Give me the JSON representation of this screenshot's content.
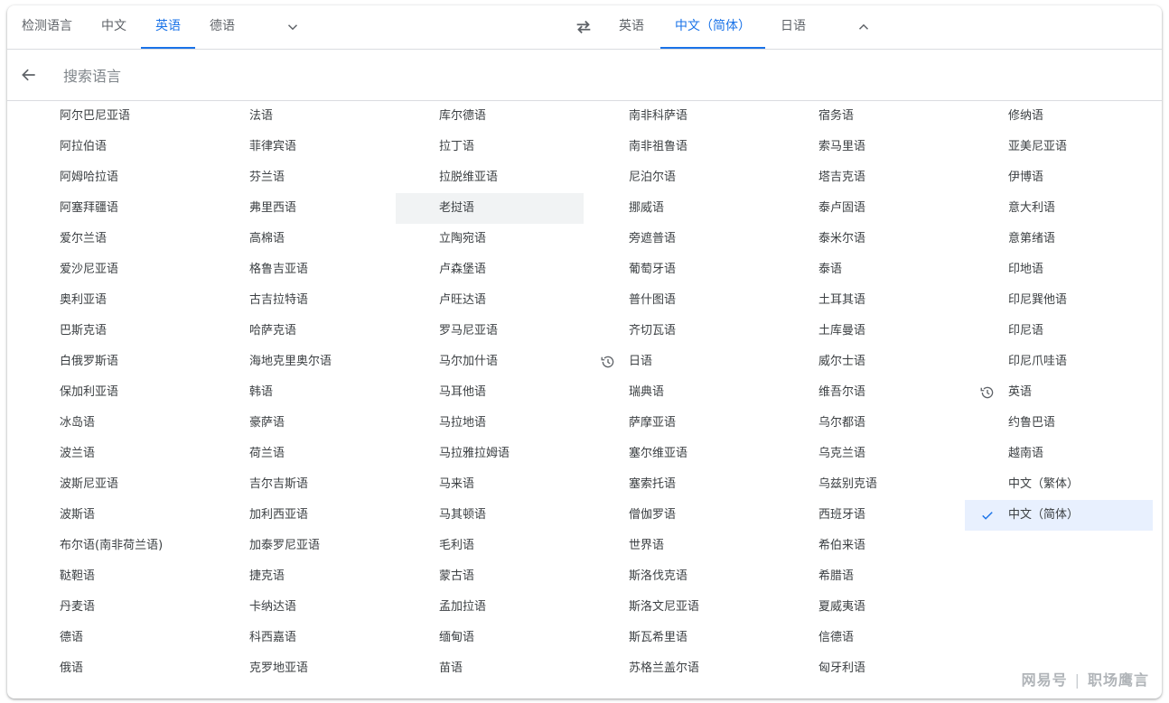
{
  "source_tabs": [
    "检测语言",
    "中文",
    "英语",
    "德语"
  ],
  "source_active_index": 2,
  "target_tabs": [
    "英语",
    "中文（简体）",
    "日语"
  ],
  "target_active_index": 1,
  "icons": {
    "expand_source": "chevron-down-icon",
    "swap": "swap-arrows-icon",
    "collapse_target": "chevron-up-icon",
    "back": "arrow-left-icon",
    "recent": "history-icon",
    "selected": "check-icon"
  },
  "search": {
    "placeholder": "搜索语言",
    "value": ""
  },
  "colors": {
    "accent": "#1a73e8",
    "selected_bg": "#e8f0fe",
    "hover_bg": "#f1f3f4"
  },
  "columns": [
    {
      "items": [
        {
          "label": "阿尔巴尼亚语"
        },
        {
          "label": "阿拉伯语"
        },
        {
          "label": "阿姆哈拉语"
        },
        {
          "label": "阿塞拜疆语"
        },
        {
          "label": "爱尔兰语"
        },
        {
          "label": "爱沙尼亚语"
        },
        {
          "label": "奥利亚语"
        },
        {
          "label": "巴斯克语"
        },
        {
          "label": "白俄罗斯语"
        },
        {
          "label": "保加利亚语"
        },
        {
          "label": "冰岛语"
        },
        {
          "label": "波兰语"
        },
        {
          "label": "波斯尼亚语"
        },
        {
          "label": "波斯语"
        },
        {
          "label": "布尔语(南非荷兰语)"
        },
        {
          "label": "鞑靼语"
        },
        {
          "label": "丹麦语"
        },
        {
          "label": "德语"
        },
        {
          "label": "俄语"
        }
      ]
    },
    {
      "items": [
        {
          "label": "法语"
        },
        {
          "label": "菲律宾语"
        },
        {
          "label": "芬兰语"
        },
        {
          "label": "弗里西语"
        },
        {
          "label": "高棉语"
        },
        {
          "label": "格鲁吉亚语"
        },
        {
          "label": "古吉拉特语"
        },
        {
          "label": "哈萨克语"
        },
        {
          "label": "海地克里奥尔语"
        },
        {
          "label": "韩语"
        },
        {
          "label": "豪萨语"
        },
        {
          "label": "荷兰语"
        },
        {
          "label": "吉尔吉斯语"
        },
        {
          "label": "加利西亚语"
        },
        {
          "label": "加泰罗尼亚语"
        },
        {
          "label": "捷克语"
        },
        {
          "label": "卡纳达语"
        },
        {
          "label": "科西嘉语"
        },
        {
          "label": "克罗地亚语"
        }
      ]
    },
    {
      "items": [
        {
          "label": "库尔德语"
        },
        {
          "label": "拉丁语"
        },
        {
          "label": "拉脱维亚语"
        },
        {
          "label": "老挝语",
          "state": "hover"
        },
        {
          "label": "立陶宛语"
        },
        {
          "label": "卢森堡语"
        },
        {
          "label": "卢旺达语"
        },
        {
          "label": "罗马尼亚语"
        },
        {
          "label": "马尔加什语"
        },
        {
          "label": "马耳他语"
        },
        {
          "label": "马拉地语"
        },
        {
          "label": "马拉雅拉姆语"
        },
        {
          "label": "马来语"
        },
        {
          "label": "马其顿语"
        },
        {
          "label": "毛利语"
        },
        {
          "label": "蒙古语"
        },
        {
          "label": "孟加拉语"
        },
        {
          "label": "缅甸语"
        },
        {
          "label": "苗语"
        }
      ]
    },
    {
      "items": [
        {
          "label": "南非科萨语"
        },
        {
          "label": "南非祖鲁语"
        },
        {
          "label": "尼泊尔语"
        },
        {
          "label": "挪威语"
        },
        {
          "label": "旁遮普语"
        },
        {
          "label": "葡萄牙语"
        },
        {
          "label": "普什图语"
        },
        {
          "label": "齐切瓦语"
        },
        {
          "label": "日语",
          "icon": "history-icon"
        },
        {
          "label": "瑞典语"
        },
        {
          "label": "萨摩亚语"
        },
        {
          "label": "塞尔维亚语"
        },
        {
          "label": "塞索托语"
        },
        {
          "label": "僧伽罗语"
        },
        {
          "label": "世界语"
        },
        {
          "label": "斯洛伐克语"
        },
        {
          "label": "斯洛文尼亚语"
        },
        {
          "label": "斯瓦希里语"
        },
        {
          "label": "苏格兰盖尔语"
        }
      ]
    },
    {
      "items": [
        {
          "label": "宿务语"
        },
        {
          "label": "索马里语"
        },
        {
          "label": "塔吉克语"
        },
        {
          "label": "泰卢固语"
        },
        {
          "label": "泰米尔语"
        },
        {
          "label": "泰语"
        },
        {
          "label": "土耳其语"
        },
        {
          "label": "土库曼语"
        },
        {
          "label": "威尔士语"
        },
        {
          "label": "维吾尔语"
        },
        {
          "label": "乌尔都语"
        },
        {
          "label": "乌克兰语"
        },
        {
          "label": "乌兹别克语"
        },
        {
          "label": "西班牙语"
        },
        {
          "label": "希伯来语"
        },
        {
          "label": "希腊语"
        },
        {
          "label": "夏威夷语"
        },
        {
          "label": "信德语"
        },
        {
          "label": "匈牙利语"
        }
      ]
    },
    {
      "items": [
        {
          "label": "修纳语"
        },
        {
          "label": "亚美尼亚语"
        },
        {
          "label": "伊博语"
        },
        {
          "label": "意大利语"
        },
        {
          "label": "意第绪语"
        },
        {
          "label": "印地语"
        },
        {
          "label": "印尼巽他语"
        },
        {
          "label": "印尼语"
        },
        {
          "label": "印尼爪哇语"
        },
        {
          "label": "英语",
          "icon": "history-icon"
        },
        {
          "label": "约鲁巴语"
        },
        {
          "label": "越南语"
        },
        {
          "label": "中文（繁体）"
        },
        {
          "label": "中文（简体）",
          "icon": "check-icon",
          "state": "selected"
        }
      ]
    }
  ],
  "watermark": {
    "left": "网易号",
    "right": "职场鹰言"
  }
}
